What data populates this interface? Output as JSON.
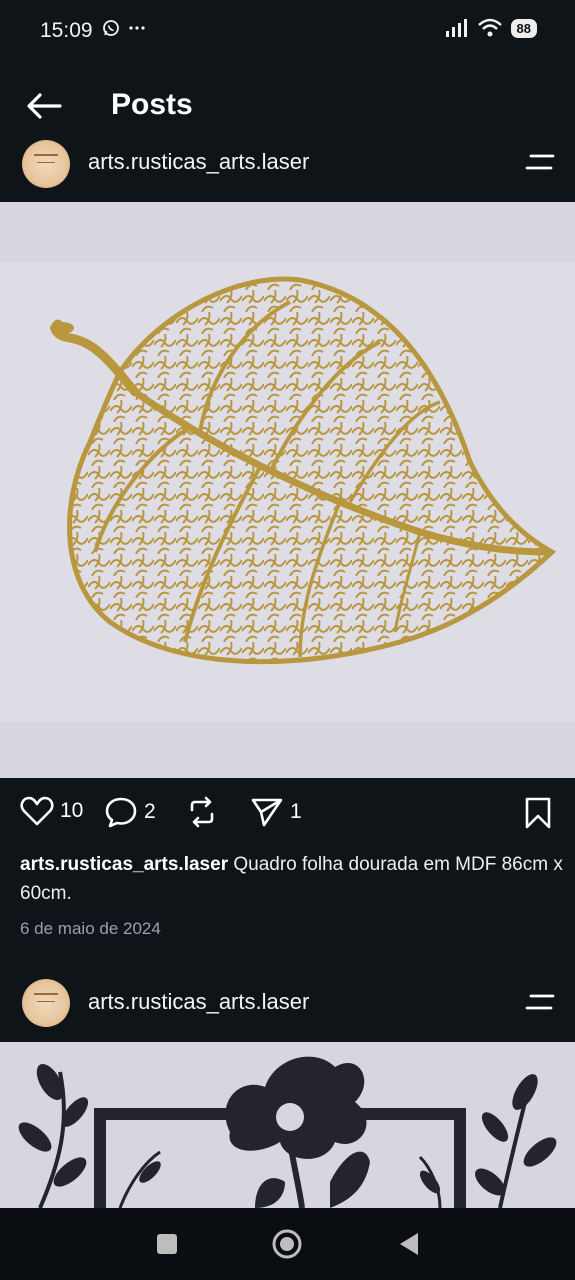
{
  "status_bar": {
    "time": "15:09",
    "left_icons": [
      "whatsapp-icon",
      "more-dots-icon"
    ],
    "right_icons": [
      "signal-icon",
      "wifi-icon",
      "battery-icon"
    ],
    "battery": "88"
  },
  "header": {
    "title": "Posts"
  },
  "posts": [
    {
      "username": "arts.rusticas_arts.laser",
      "image": "gold-leaf-laser-cut-art",
      "likes": "10",
      "comments": "2",
      "shares": "1",
      "caption": "Quadro folha dourada em MDF 86cm x 60cm.",
      "date": "6 de maio de 2024"
    },
    {
      "username": "arts.rusticas_arts.laser",
      "image": "dark-flower-frame-laser-cut-art"
    }
  ],
  "colors": {
    "background": "#0f1419",
    "leaf_gold": "#b8973f",
    "image_bg": "#d7d6e0"
  }
}
